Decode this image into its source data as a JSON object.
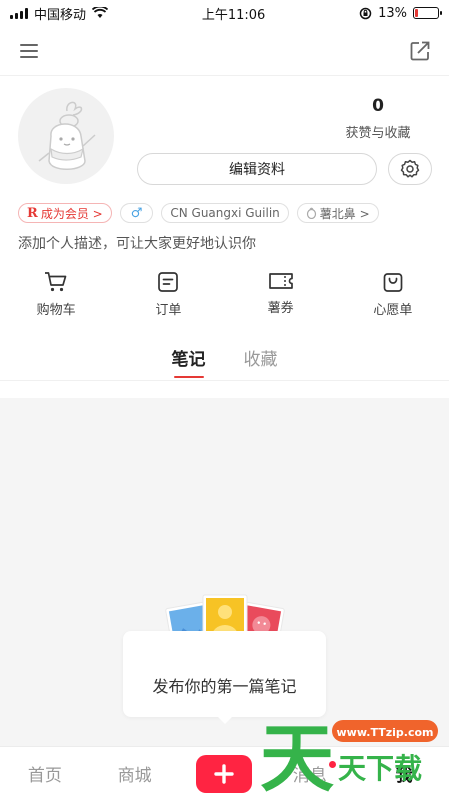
{
  "status": {
    "carrier": "中国移动",
    "time": "上午11:06",
    "battery": "13%",
    "battery_level": 0.13
  },
  "profile": {
    "stat_count": "0",
    "stat_label": "获赞与收藏",
    "edit_label": "编辑资料"
  },
  "tags": {
    "vip_r": "R",
    "vip_label": "成为会员 >",
    "gender": "♂",
    "location": "CN Guangxi Guilin",
    "badge_label": "薯北鼻 >"
  },
  "description": "添加个人描述，可让大家更好地认识你",
  "quick": [
    {
      "label": "购物车",
      "icon": "cart-icon"
    },
    {
      "label": "订单",
      "icon": "order-icon"
    },
    {
      "label": "薯券",
      "icon": "coupon-icon"
    },
    {
      "label": "心愿单",
      "icon": "wishlist-icon"
    }
  ],
  "tabs": [
    {
      "label": "笔记",
      "active": true
    },
    {
      "label": "收藏",
      "active": false
    }
  ],
  "empty_text": "发布你的第一篇笔记",
  "bottom_nav": {
    "home": "首页",
    "mall": "商城",
    "plus": "+",
    "messages": "消息",
    "me": "我"
  },
  "watermark": {
    "char": "天",
    "url": "www.TTzip.com",
    "text": "天下载"
  },
  "colors": {
    "accent": "#ff2442",
    "link_blue": "#4aa3e3"
  }
}
